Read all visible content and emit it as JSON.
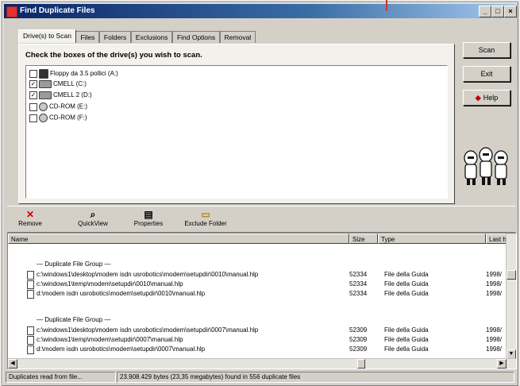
{
  "window": {
    "title": "Find Duplicate Files"
  },
  "tabs": [
    {
      "label": "Drive(s) to Scan",
      "active": true
    },
    {
      "label": "Files"
    },
    {
      "label": "Folders"
    },
    {
      "label": "Exclusions"
    },
    {
      "label": "Find Options"
    },
    {
      "label": "Removal"
    }
  ],
  "scan_panel": {
    "instructions": "Check the boxes of the drive(s) you wish to scan.",
    "drives": [
      {
        "label": "Floppy da 3.5 pollici (A:)",
        "checked": false,
        "icon": "floppy-icon"
      },
      {
        "label": "CMELL (C:)",
        "checked": true,
        "icon": "hard-drive-icon"
      },
      {
        "label": "CMELL 2 (D:)",
        "checked": true,
        "icon": "hard-drive-icon"
      },
      {
        "label": "CD-ROM (E:)",
        "checked": false,
        "icon": "cd-rom-icon"
      },
      {
        "label": "CD-ROM (F:)",
        "checked": false,
        "icon": "cd-rom-icon"
      }
    ]
  },
  "side_buttons": {
    "scan": "Scan",
    "exit": "Exit",
    "help": "Help"
  },
  "toolbar": {
    "remove": "Remove",
    "quickview": "QuickView",
    "properties": "Properties",
    "exclude_folder": "Exclude Folder"
  },
  "results": {
    "columns": {
      "name": "Name",
      "size": "Size",
      "type": "Type",
      "last": "Last h"
    },
    "groups": [
      {
        "header": "— Duplicate File Group —",
        "files": [
          {
            "path": "c:\\windows1\\desktop\\modem isdn usrobotics\\modem\\setupdir\\0010\\manual.hlp",
            "size": "52334",
            "type": "File della Guida",
            "date": "1998/"
          },
          {
            "path": "c:\\windows1\\temp\\modem\\setupdir\\0010\\manual.hlp",
            "size": "52334",
            "type": "File della Guida",
            "date": "1998/"
          },
          {
            "path": "d:\\modem isdn usrobotics\\modem\\setupdir\\0010\\manual.hlp",
            "size": "52334",
            "type": "File della Guida",
            "date": "1998/"
          }
        ]
      },
      {
        "header": "— Duplicate File Group —",
        "files": [
          {
            "path": "c:\\windows1\\desktop\\modem isdn usrobotics\\modem\\setupdir\\0007\\manual.hlp",
            "size": "52309",
            "type": "File della Guida",
            "date": "1998/"
          },
          {
            "path": "c:\\windows1\\temp\\modem\\setupdir\\0007\\manual.hlp",
            "size": "52309",
            "type": "File della Guida",
            "date": "1998/"
          },
          {
            "path": "d:\\modem isdn usrobotics\\modem\\setupdir\\0007\\manual.hlp",
            "size": "52309",
            "type": "File della Guida",
            "date": "1998/"
          }
        ]
      }
    ]
  },
  "status": {
    "left": "Duplicates read from file...",
    "right": "23.908.429 bytes (23,35 megabytes) found in 556 duplicate files"
  }
}
